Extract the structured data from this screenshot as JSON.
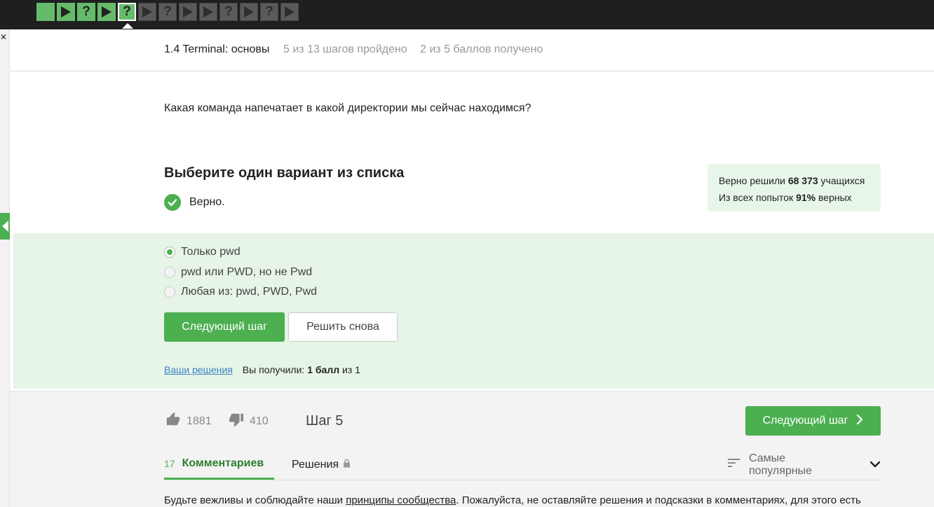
{
  "steps": [
    {
      "kind": "done",
      "glyph": ""
    },
    {
      "kind": "done",
      "glyph": "play"
    },
    {
      "kind": "done",
      "glyph": "?"
    },
    {
      "kind": "done",
      "glyph": "play"
    },
    {
      "kind": "current",
      "glyph": "?"
    },
    {
      "kind": "todo",
      "glyph": "play"
    },
    {
      "kind": "todo",
      "glyph": "?"
    },
    {
      "kind": "todo",
      "glyph": "play"
    },
    {
      "kind": "todo",
      "glyph": "play"
    },
    {
      "kind": "todo",
      "glyph": "?"
    },
    {
      "kind": "todo",
      "glyph": "play"
    },
    {
      "kind": "todo",
      "glyph": "?"
    },
    {
      "kind": "todo",
      "glyph": "play"
    }
  ],
  "lesson": {
    "title": "1.4 Terminal: основы",
    "progress": "5 из 13 шагов пройдено",
    "score": "2 из 5 баллов  получено"
  },
  "question": "Какая команда напечатает в какой директории мы сейчас находимся?",
  "choose_title": "Выберите один вариант из списка",
  "correct_text": "Верно.",
  "stats": {
    "solved_prefix": "Верно решили ",
    "solved_count": "68 373",
    "solved_suffix": " учащихся",
    "attempts_prefix": "Из всех попыток ",
    "attempts_percent": "91%",
    "attempts_suffix": " верных"
  },
  "options": [
    {
      "label": "Только pwd",
      "selected": true
    },
    {
      "label": "pwd или PWD, но не Pwd",
      "selected": false
    },
    {
      "label": "Любая из: pwd, PWD, Pwd",
      "selected": false
    }
  ],
  "buttons": {
    "next": "Следующий шаг",
    "retry": "Решить снова"
  },
  "solutions": {
    "link": "Ваши решения",
    "got_prefix": "Вы получили: ",
    "got_value": "1 балл",
    "got_suffix": " из 1"
  },
  "footer": {
    "likes": "1881",
    "dislikes": "410",
    "step_label": "Шаг 5",
    "next": "Следующий шаг"
  },
  "tabs": {
    "comments_count": "17",
    "comments_label": "Комментариев",
    "solutions_label": "Решения",
    "sort_label": "Самые популярные"
  },
  "notice": {
    "before": "Будьте вежливы и соблюдайте наши ",
    "link": "принципы сообщества",
    "after": ". Пожалуйста, не оставляйте решения и подсказки в комментариях, для этого есть"
  },
  "colors": {
    "accent": "#4caf50",
    "panel": "#e6f5e6",
    "topbar": "#1f1f1f"
  }
}
